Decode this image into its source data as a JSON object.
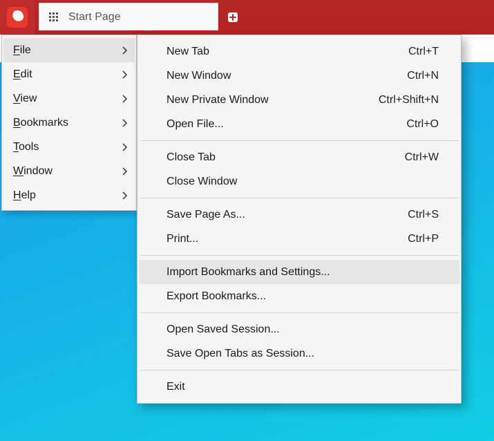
{
  "tab": {
    "title": "Start Page"
  },
  "mainMenu": {
    "items": [
      {
        "label": "File",
        "u": "F",
        "rest": "ile",
        "selected": true
      },
      {
        "label": "Edit",
        "u": "E",
        "rest": "dit",
        "selected": false
      },
      {
        "label": "View",
        "u": "V",
        "rest": "iew",
        "selected": false
      },
      {
        "label": "Bookmarks",
        "u": "B",
        "rest": "ookmarks",
        "selected": false
      },
      {
        "label": "Tools",
        "u": "T",
        "rest": "ools",
        "selected": false
      },
      {
        "label": "Window",
        "u": "W",
        "rest": "indow",
        "selected": false
      },
      {
        "label": "Help",
        "u": "H",
        "rest": "elp",
        "selected": false
      }
    ]
  },
  "fileMenu": {
    "groups": [
      [
        {
          "pre": "",
          "u": "N",
          "post": "ew Tab",
          "shortcut": "Ctrl+T",
          "hover": false
        },
        {
          "pre": "New ",
          "u": "W",
          "post": "indow",
          "shortcut": "Ctrl+N",
          "hover": false
        },
        {
          "pre": "New ",
          "u": "P",
          "post": "rivate Window",
          "shortcut": "Ctrl+Shift+N",
          "hover": false
        },
        {
          "pre": "",
          "u": "O",
          "post": "pen File...",
          "shortcut": "Ctrl+O",
          "hover": false
        }
      ],
      [
        {
          "pre": "",
          "u": "C",
          "post": "lose Tab",
          "shortcut": "Ctrl+W",
          "hover": false
        },
        {
          "pre": "C",
          "u": "l",
          "post": "ose Window",
          "shortcut": "",
          "hover": false
        }
      ],
      [
        {
          "pre": "",
          "u": "S",
          "post": "ave Page As...",
          "shortcut": "Ctrl+S",
          "hover": false
        },
        {
          "pre": "Pr",
          "u": "i",
          "post": "nt...",
          "shortcut": "Ctrl+P",
          "hover": false
        }
      ],
      [
        {
          "pre": "",
          "u": "I",
          "post": "mport Bookmarks and Settings...",
          "shortcut": "",
          "hover": true
        },
        {
          "pre": "",
          "u": "E",
          "post": "xport Bookmarks...",
          "shortcut": "",
          "hover": false
        }
      ],
      [
        {
          "pre": "Open S",
          "u": "a",
          "post": "ved Session...",
          "shortcut": "",
          "hover": false
        },
        {
          "pre": "Save Open ",
          "u": "T",
          "post": "abs as Session...",
          "shortcut": "",
          "hover": false
        }
      ],
      [
        {
          "pre": "E",
          "u": "x",
          "post": "it",
          "shortcut": "",
          "hover": false
        }
      ]
    ]
  }
}
